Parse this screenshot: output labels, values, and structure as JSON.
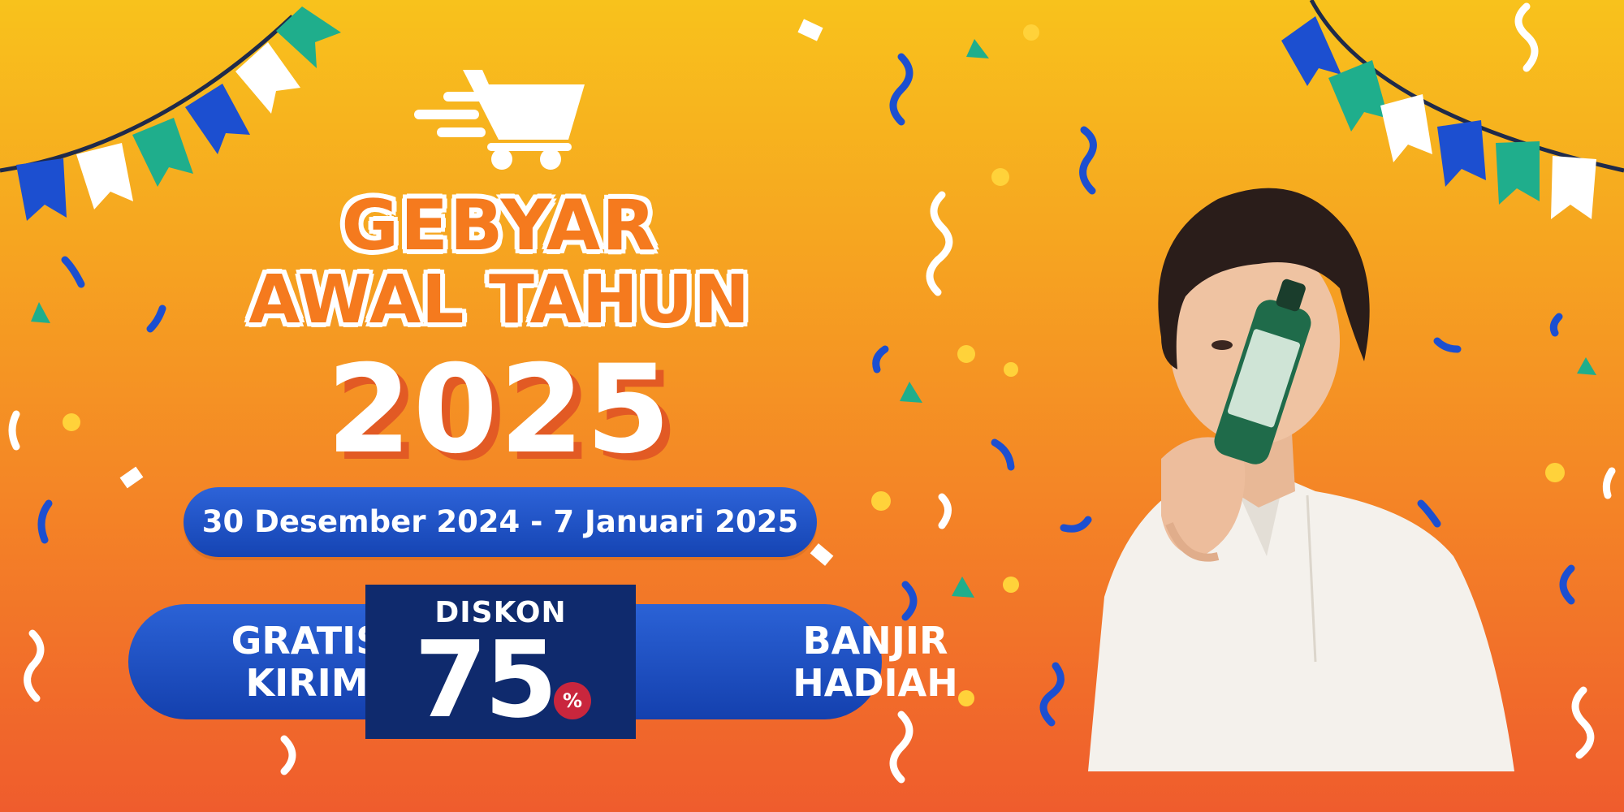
{
  "headline": {
    "line1": "GEBYAR",
    "line2": "AWAL TAHUN",
    "year": "2025"
  },
  "date_range": "30 Desember 2024 - 7 Januari 2025",
  "offers": {
    "left": [
      "GRATIS",
      "KIRIM"
    ],
    "center_label": "DISKON",
    "center_value": "75",
    "center_unit": "%",
    "right": [
      "BANJIR",
      "HADIAH"
    ]
  },
  "colors": {
    "background_top": "#f8c21c",
    "background_bottom": "#ef5c2d",
    "headline_orange": "#f57a1e",
    "pill_blue": "#1544b3",
    "discount_navy": "#0f2a6d",
    "percent_red": "#c9263d",
    "pennant_blue": "#1c4fd0",
    "pennant_teal": "#1fae8c",
    "confetti_yellow": "#ffd23a"
  },
  "icons": [
    "shopping-cart-icon",
    "bunting-garland",
    "confetti"
  ]
}
